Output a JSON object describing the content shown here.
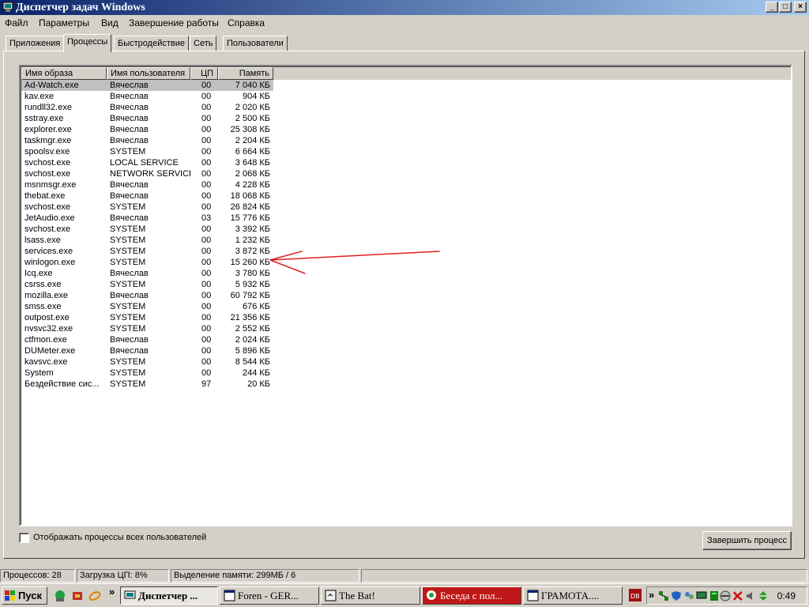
{
  "window": {
    "title": "Диспетчер задач Windows"
  },
  "window_buttons": {
    "minimize": "_",
    "maximize": "□",
    "close": "×"
  },
  "menu": [
    "Файл",
    "Параметры",
    "Вид",
    "Завершение работы",
    "Справка"
  ],
  "tabs": [
    "Приложения",
    "Процессы",
    "Быстродействие",
    "Сеть",
    "Пользователи"
  ],
  "active_tab": "Процессы",
  "table": {
    "columns": [
      "Имя образа",
      "Имя пользователя",
      "ЦП",
      "Память"
    ],
    "rows": [
      [
        "Ad-Watch.exe",
        "Вячеслав",
        "00",
        "7 040 КБ"
      ],
      [
        "kav.exe",
        "Вячеслав",
        "00",
        "904 КБ"
      ],
      [
        "rundll32.exe",
        "Вячеслав",
        "00",
        "2 020 КБ"
      ],
      [
        "sstray.exe",
        "Вячеслав",
        "00",
        "2 500 КБ"
      ],
      [
        "explorer.exe",
        "Вячеслав",
        "00",
        "25 308 КБ"
      ],
      [
        "taskmgr.exe",
        "Вячеслав",
        "00",
        "2 204 КБ"
      ],
      [
        "spoolsv.exe",
        "SYSTEM",
        "00",
        "6 664 КБ"
      ],
      [
        "svchost.exe",
        "LOCAL SERVICE",
        "00",
        "3 648 КБ"
      ],
      [
        "svchost.exe",
        "NETWORK SERVICE",
        "00",
        "2 068 КБ"
      ],
      [
        "msnmsgr.exe",
        "Вячеслав",
        "00",
        "4 228 КБ"
      ],
      [
        "thebat.exe",
        "Вячеслав",
        "00",
        "18 068 КБ"
      ],
      [
        "svchost.exe",
        "SYSTEM",
        "00",
        "26 824 КБ"
      ],
      [
        "JetAudio.exe",
        "Вячеслав",
        "03",
        "15 776 КБ"
      ],
      [
        "svchost.exe",
        "SYSTEM",
        "00",
        "3 392 КБ"
      ],
      [
        "lsass.exe",
        "SYSTEM",
        "00",
        "1 232 КБ"
      ],
      [
        "services.exe",
        "SYSTEM",
        "00",
        "3 872 КБ"
      ],
      [
        "winlogon.exe",
        "SYSTEM",
        "00",
        "15 260 КБ"
      ],
      [
        "Icq.exe",
        "Вячеслав",
        "00",
        "3 780 КБ"
      ],
      [
        "csrss.exe",
        "SYSTEM",
        "00",
        "5 932 КБ"
      ],
      [
        "mozilla.exe",
        "Вячеслав",
        "00",
        "60 792 КБ"
      ],
      [
        "smss.exe",
        "SYSTEM",
        "00",
        "676 КБ"
      ],
      [
        "outpost.exe",
        "SYSTEM",
        "00",
        "21 356 КБ"
      ],
      [
        "nvsvc32.exe",
        "SYSTEM",
        "00",
        "2 552 КБ"
      ],
      [
        "ctfmon.exe",
        "Вячеслав",
        "00",
        "2 024 КБ"
      ],
      [
        "DUMeter.exe",
        "Вячеслав",
        "00",
        "5 896 КБ"
      ],
      [
        "kavsvc.exe",
        "SYSTEM",
        "00",
        "8 544 КБ"
      ],
      [
        "System",
        "SYSTEM",
        "00",
        "244 КБ"
      ],
      [
        "Бездействие сис...",
        "SYSTEM",
        "97",
        "20 КБ"
      ]
    ],
    "selected_row": 0
  },
  "annotation": {
    "color": "#e02020",
    "points_to": "winlogon.exe"
  },
  "show_all_users": {
    "label": "Отображать процессы всех пользователей",
    "checked": false
  },
  "end_process_button": "Завершить процесс",
  "status": {
    "processes": "Процессов: 28",
    "cpu": "Загрузка ЦП: 8%",
    "memory": "Выделение памяти: 299МБ / 6"
  },
  "taskbar": {
    "start": "Пуск",
    "overflow": "»",
    "tasks": [
      {
        "label": "Диспетчер ...",
        "icon": "taskmgr-icon",
        "state": "active"
      },
      {
        "label": "Foren - GER...",
        "icon": "window-icon",
        "state": "normal"
      },
      {
        "label": "The Bat!",
        "icon": "bat-icon",
        "state": "normal"
      },
      {
        "label": "Беседа с пол...",
        "icon": "chat-icon",
        "state": "red"
      },
      {
        "label": "ГРАМОТА....",
        "icon": "window-icon",
        "state": "normal"
      }
    ],
    "clock": "0:49"
  }
}
